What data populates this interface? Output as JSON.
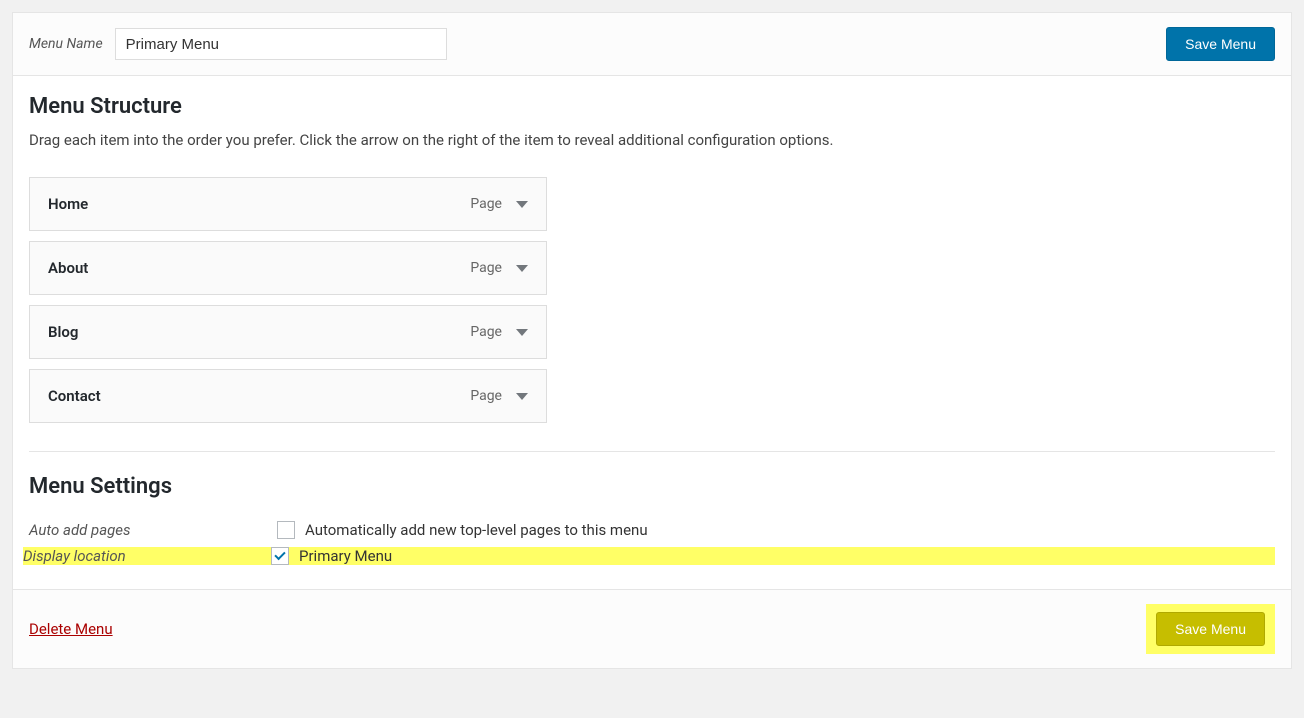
{
  "header": {
    "menu_name_label": "Menu Name",
    "menu_name_value": "Primary Menu",
    "save_button": "Save Menu"
  },
  "structure": {
    "heading": "Menu Structure",
    "description": "Drag each item into the order you prefer. Click the arrow on the right of the item to reveal additional configuration options.",
    "items": [
      {
        "title": "Home",
        "type": "Page"
      },
      {
        "title": "About",
        "type": "Page"
      },
      {
        "title": "Blog",
        "type": "Page"
      },
      {
        "title": "Contact",
        "type": "Page"
      }
    ]
  },
  "settings": {
    "heading": "Menu Settings",
    "auto_add_label": "Auto add pages",
    "auto_add_option": "Automatically add new top-level pages to this menu",
    "display_location_label": "Display location",
    "display_location_option": "Primary Menu"
  },
  "footer": {
    "delete_label": "Delete Menu",
    "save_button": "Save Menu"
  }
}
